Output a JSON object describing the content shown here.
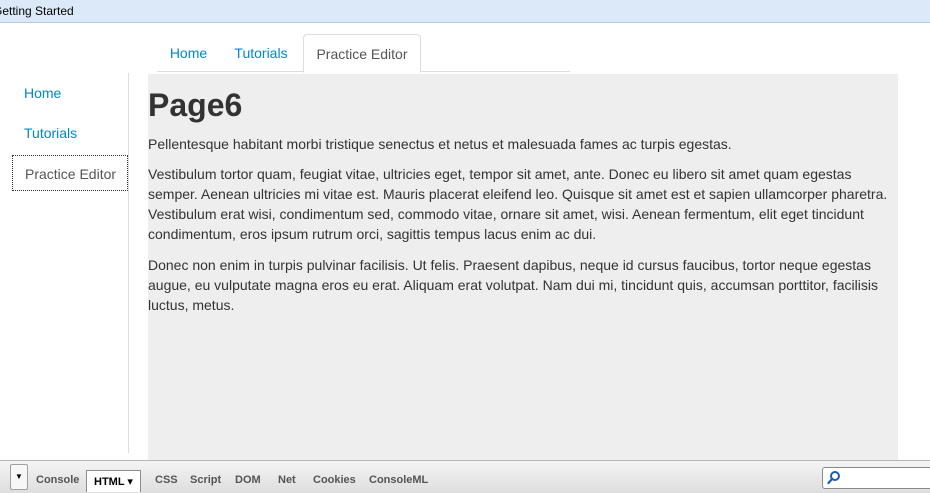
{
  "window": {
    "title": "Getting Started"
  },
  "top_tabs": [
    {
      "label": "Home"
    },
    {
      "label": "Tutorials"
    },
    {
      "label": "Practice Editor"
    }
  ],
  "side_nav": [
    {
      "label": "Home"
    },
    {
      "label": "Tutorials"
    },
    {
      "label": "Practice Editor"
    }
  ],
  "content": {
    "heading": "Page6",
    "paragraphs": [
      "Pellentesque habitant morbi tristique senectus et netus et malesuada fames ac turpis egestas.",
      "Vestibulum tortor quam, feugiat vitae, ultricies eget, tempor sit amet, ante. Donec eu libero sit amet quam egestas semper. Aenean ultricies mi vitae est. Mauris placerat eleifend leo. Quisque sit amet est et sapien ullamcorper pharetra. Vestibulum erat wisi, condimentum sed, commodo vitae, ornare sit amet, wisi. Aenean fermentum, elit eget tincidunt condimentum, eros ipsum rutrum orci, sagittis tempus lacus enim ac dui.",
      "Donec non enim in turpis pulvinar facilisis. Ut felis. Praesent dapibus, neque id cursus faucibus, tortor neque egestas augue, eu vulputate magna eros eu erat. Aliquam erat volutpat. Nam dui mi, tincidunt quis, accumsan porttitor, facilisis luctus, metus."
    ]
  },
  "devtools": {
    "menu_icon": "triangle-down-icon",
    "tabs": [
      {
        "label": "Console"
      },
      {
        "label": "HTML ▾"
      },
      {
        "label": "CSS"
      },
      {
        "label": "Script"
      },
      {
        "label": "DOM"
      },
      {
        "label": "Net"
      },
      {
        "label": "Cookies"
      },
      {
        "label": "ConsoleML"
      }
    ],
    "search_icon": "magnifier-icon",
    "search_value": ""
  },
  "colors": {
    "link": "#0088cc",
    "content_bg": "#eeeeee",
    "titlebar_bg": "#dce9f8"
  }
}
